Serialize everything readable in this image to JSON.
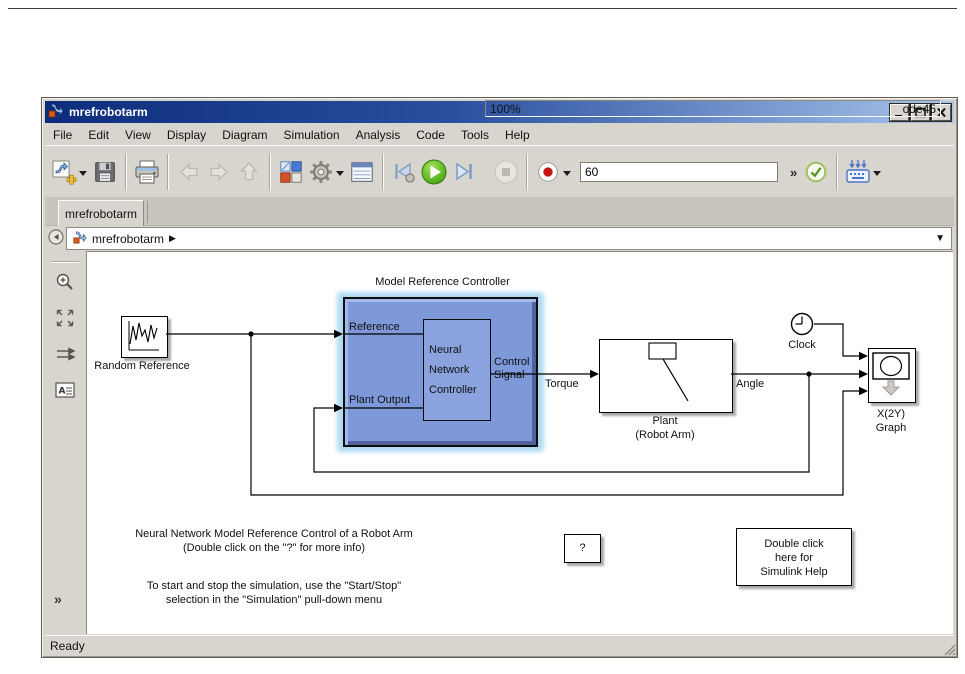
{
  "window": {
    "title": "mrefrobotarm",
    "controls": [
      "minimize",
      "maximize",
      "close"
    ]
  },
  "menu": {
    "items": [
      "File",
      "Edit",
      "View",
      "Display",
      "Diagram",
      "Simulation",
      "Analysis",
      "Code",
      "Tools",
      "Help"
    ]
  },
  "toolbar": {
    "sim_stop_time": "60",
    "overflow_chevron": "»",
    "icons": [
      "new-model",
      "save",
      "print",
      "navigate-back",
      "navigate-forward",
      "navigate-up",
      "library-browser",
      "model-settings-gear",
      "model-configuration",
      "step-back",
      "run",
      "step-forward",
      "stop",
      "record",
      "validate-check",
      "keyboard-shortcuts"
    ]
  },
  "tabs": {
    "active": "mrefrobotarm"
  },
  "breadcrumb": {
    "model": "mrefrobotarm",
    "caret": "▶",
    "dropdown": "▼"
  },
  "sidebar": {
    "collapsed_chevron": "»",
    "icons": [
      "hide-explorer-bar",
      "zoom-in",
      "fit-to-view",
      "route-signals",
      "annotation"
    ]
  },
  "canvas": {
    "blocks": {
      "random_reference": {
        "label": "Random Reference"
      },
      "controller": {
        "title": "Model Reference Controller",
        "input1": "Reference",
        "input2": "Plant Output",
        "inner_line1": "Neural",
        "inner_line2": "Network",
        "inner_line3": "Controller",
        "output_line1": "Control",
        "output_line2": "Signal"
      },
      "plant": {
        "label_line1": "Plant",
        "label_line2": "(Robot Arm)"
      },
      "clock": {
        "label": "Clock"
      },
      "xy_graph": {
        "label_line1": "X(2Y)",
        "label_line2": "Graph"
      },
      "question": {
        "label": "?"
      },
      "help": {
        "line1": "Double click",
        "line2": "here for",
        "line3": "Simulink Help"
      }
    },
    "signals": {
      "torque": "Torque",
      "angle": "Angle"
    },
    "annotations": {
      "note1_line1": "Neural Network Model Reference Control of a Robot Arm",
      "note1_line2": "(Double click on the \"?\" for more info)",
      "note2_line1": "To start and stop the simulation, use the \"Start/Stop\"",
      "note2_line2": "selection in the \"Simulation\" pull-down menu"
    }
  },
  "statusbar": {
    "status": "Ready",
    "zoom": "100%",
    "solver": "ode45"
  }
}
